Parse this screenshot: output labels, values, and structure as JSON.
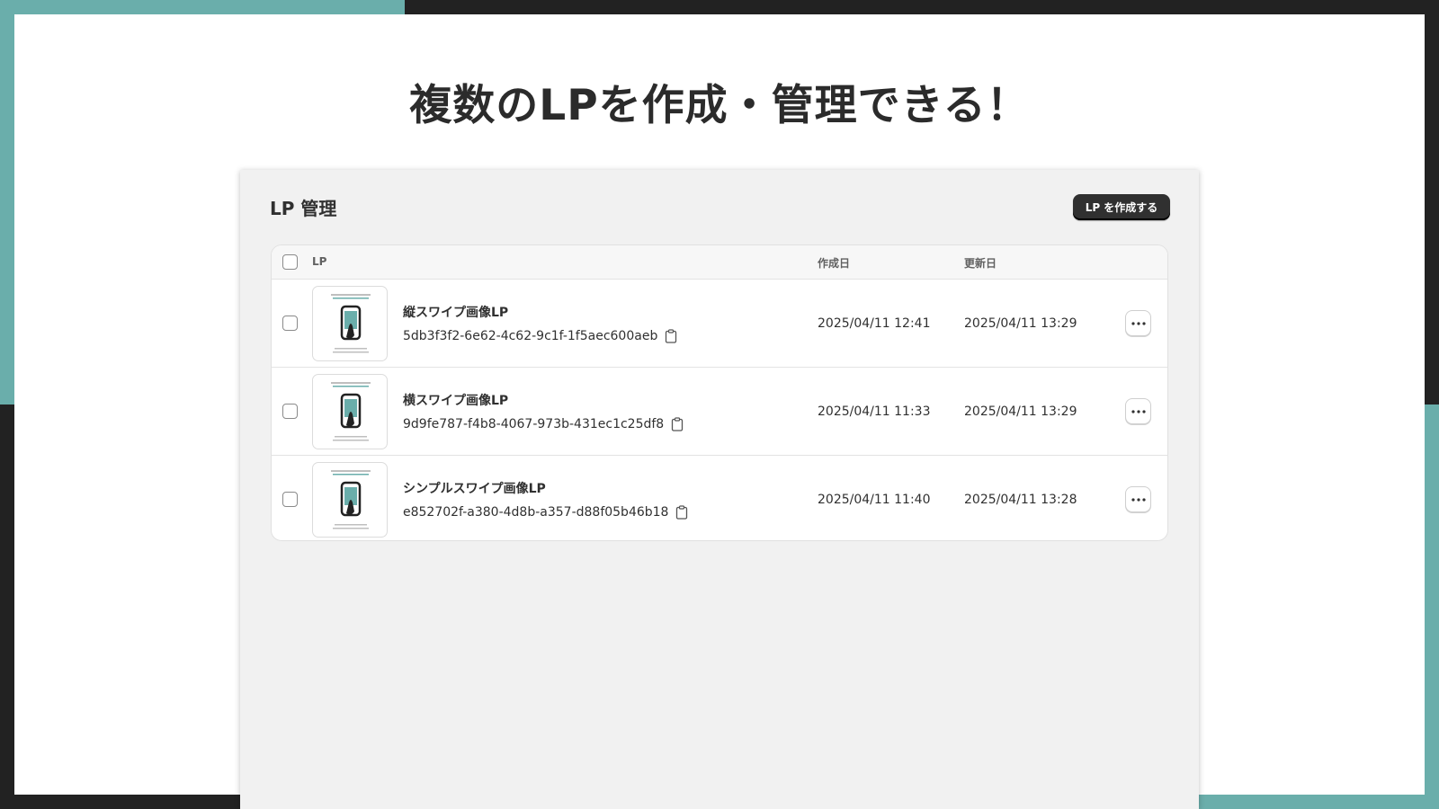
{
  "headline": "複数のLPを作成・管理できる！",
  "panel": {
    "title": "LP 管理",
    "create_button": "LP を作成する"
  },
  "table": {
    "headers": {
      "lp": "LP",
      "created": "作成日",
      "updated": "更新日"
    },
    "rows": [
      {
        "name": "縦スワイプ画像LP",
        "id": "5db3f3f2-6e62-4c62-9c1f-1f5aec600aeb",
        "created": "2025/04/11 12:41",
        "updated": "2025/04/11 13:29"
      },
      {
        "name": "横スワイプ画像LP",
        "id": "9d9fe787-f4b8-4067-973b-431ec1c25df8",
        "created": "2025/04/11 11:33",
        "updated": "2025/04/11 13:29"
      },
      {
        "name": "シンプルスワイプ画像LP",
        "id": "e852702f-a380-4d8b-a357-d88f05b46b18",
        "created": "2025/04/11 11:40",
        "updated": "2025/04/11 13:28"
      }
    ]
  },
  "colors": {
    "accent_teal": "#6aaeab",
    "frame_dark": "#222222",
    "button_dark": "#303030"
  },
  "icons": {
    "copy": "clipboard-icon",
    "more": "ellipsis-icon"
  }
}
